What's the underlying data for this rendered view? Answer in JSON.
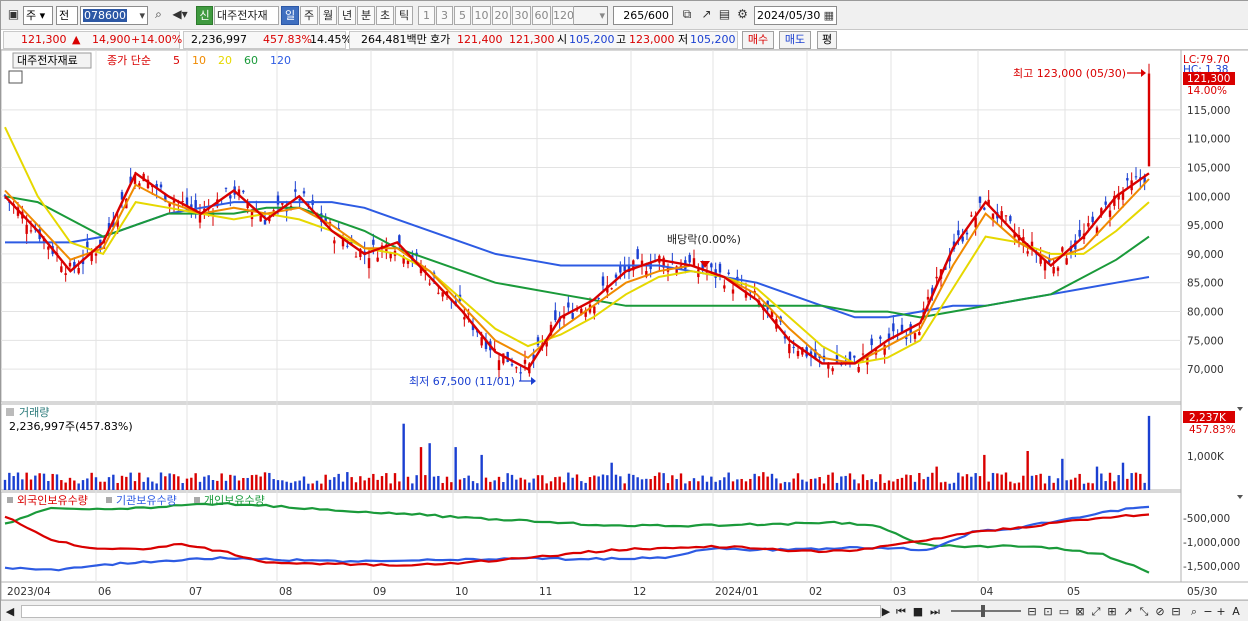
{
  "toolbar": {
    "market": "주",
    "market2": "전",
    "code": "078600",
    "badge": "신",
    "stock_name": "대주전자재",
    "periods": [
      "일",
      "주",
      "월",
      "년",
      "분",
      "초",
      "틱"
    ],
    "active_period": "일",
    "ranges": [
      "1",
      "3",
      "5",
      "10",
      "20",
      "30",
      "60",
      "120"
    ],
    "count_value": "265",
    "count_total": "/600",
    "date_value": "2024/05/30"
  },
  "pricebar": {
    "price": "121,300",
    "change": "14,900",
    "change_pct": "+14.00%",
    "volume": "2,236,997",
    "vol_ratio": "457.83%",
    "turnover": "14.45%",
    "amount": "264,481백만",
    "quote_label": "호가",
    "ask": "121,400",
    "bid": "121,300",
    "open_label": "시",
    "open": "105,200",
    "high_label": "고",
    "high": "123,000",
    "low_label": "저",
    "low": "105,200",
    "buy_label": "매수",
    "sell_label": "매도",
    "extra_label": "평"
  },
  "price_panel": {
    "name_box": "대주전자재료",
    "legend_prefix": "종가 단순",
    "ma_labels": [
      {
        "label": "5",
        "color": "#d90000"
      },
      {
        "label": "10",
        "color": "#f08a00"
      },
      {
        "label": "20",
        "color": "#e6d800"
      },
      {
        "label": "60",
        "color": "#1a9a3a"
      },
      {
        "label": "120",
        "color": "#2d5be3"
      }
    ],
    "lc": "LC:79.70",
    "hc": "HC: 1.38",
    "current_tag": "121,300",
    "current_pct": "14.00%",
    "high_annotation": "최고 123,000 (05/30)",
    "low_annotation": "최저 67,500 (11/01)",
    "dividend_annotation": "배당락(0.00%)",
    "y_ticks": [
      "115,000",
      "110,000",
      "105,000",
      "100,000",
      "95,000",
      "90,000",
      "85,000",
      "80,000",
      "75,000",
      "70,000"
    ]
  },
  "volume_panel": {
    "title": "거래량",
    "value": "2,236,997주(457.83%)",
    "tag": "2,237K",
    "tag_pct": "457.83%",
    "y_ticks": [
      "1,000K"
    ]
  },
  "holdings_panel": {
    "legend": [
      {
        "label": "외국인보유수량",
        "color": "#d90000"
      },
      {
        "label": "기관보유수량",
        "color": "#2d5be3"
      },
      {
        "label": "개인보유수량",
        "color": "#1a9a3a"
      }
    ],
    "y_ticks": [
      "-500,000",
      "-1,000,000",
      "-1,500,000"
    ]
  },
  "x_axis": {
    "labels": [
      "2023/04",
      "06",
      "07",
      "08",
      "09",
      "10",
      "11",
      "12",
      "2024/01",
      "02",
      "03",
      "04",
      "05"
    ],
    "last_label": "05/30"
  },
  "chart_data": {
    "type": "line",
    "subtype": "candlestick-with-moving-averages",
    "x_labels": [
      "2023/04",
      "06",
      "07",
      "08",
      "09",
      "10",
      "11",
      "12",
      "2024/01",
      "02",
      "03",
      "04",
      "05",
      "05/30"
    ],
    "price_ylim": [
      65000,
      124000
    ],
    "current_price": 121300,
    "period_high": {
      "value": 123000,
      "date": "05/30"
    },
    "period_low": {
      "value": 67500,
      "date": "11/01"
    },
    "moving_averages": [
      {
        "name": "5",
        "values": [
          100000,
          94000,
          87000,
          92000,
          104000,
          100000,
          97000,
          101000,
          96000,
          100000,
          94000,
          90000,
          92000,
          86000,
          80000,
          73000,
          70000,
          79000,
          82000,
          87000,
          89000,
          88000,
          86000,
          82000,
          75000,
          71000,
          71000,
          75000,
          78000,
          91000,
          99000,
          93000,
          88000,
          93000,
          100000,
          104000
        ]
      },
      {
        "name": "10",
        "values": [
          101000,
          95000,
          89000,
          91000,
          102000,
          99000,
          97000,
          98000,
          97000,
          98000,
          95000,
          91000,
          91000,
          87000,
          81000,
          75000,
          72000,
          77000,
          81000,
          85000,
          87000,
          88000,
          86000,
          83000,
          77000,
          72000,
          71000,
          74000,
          77000,
          88000,
          97000,
          92000,
          89000,
          91000,
          97000,
          103000
        ]
      },
      {
        "name": "20",
        "values": [
          112000,
          100000,
          92000,
          90000,
          99000,
          98000,
          97000,
          96000,
          97000,
          96000,
          94000,
          91000,
          90000,
          87000,
          82000,
          77000,
          74000,
          76000,
          79000,
          83000,
          86000,
          87000,
          86000,
          84000,
          79000,
          74000,
          71000,
          72000,
          75000,
          84000,
          93000,
          92000,
          90000,
          90000,
          94000,
          99000
        ]
      },
      {
        "name": "60",
        "values": [
          100000,
          99000,
          96000,
          93000,
          95000,
          97000,
          97000,
          97000,
          98000,
          98000,
          96000,
          94000,
          91000,
          89000,
          87000,
          85000,
          84000,
          83000,
          82000,
          81000,
          81000,
          81000,
          81000,
          81000,
          81000,
          81000,
          80000,
          80000,
          79000,
          80000,
          81000,
          82000,
          83000,
          86000,
          89000,
          93000
        ]
      },
      {
        "name": "120",
        "values": [
          92000,
          92000,
          92000,
          93000,
          95000,
          97000,
          98000,
          99000,
          99000,
          99000,
          99000,
          98000,
          96000,
          94000,
          92000,
          90000,
          89000,
          88000,
          88000,
          88000,
          88000,
          87000,
          86000,
          85000,
          83000,
          81000,
          79000,
          79000,
          80000,
          81000,
          81000,
          82000,
          83000,
          84000,
          85000,
          86000
        ]
      }
    ],
    "volume_last": 2236997,
    "volume_ratio_pct": 457.83,
    "holdings_series": [
      "외국인보유수량",
      "기관보유수량",
      "개인보유수량"
    ]
  },
  "bottombar": {
    "nav": [
      "▶",
      "⏮",
      "■",
      "⏭"
    ],
    "tools": [
      "−",
      "+",
      "A"
    ]
  }
}
